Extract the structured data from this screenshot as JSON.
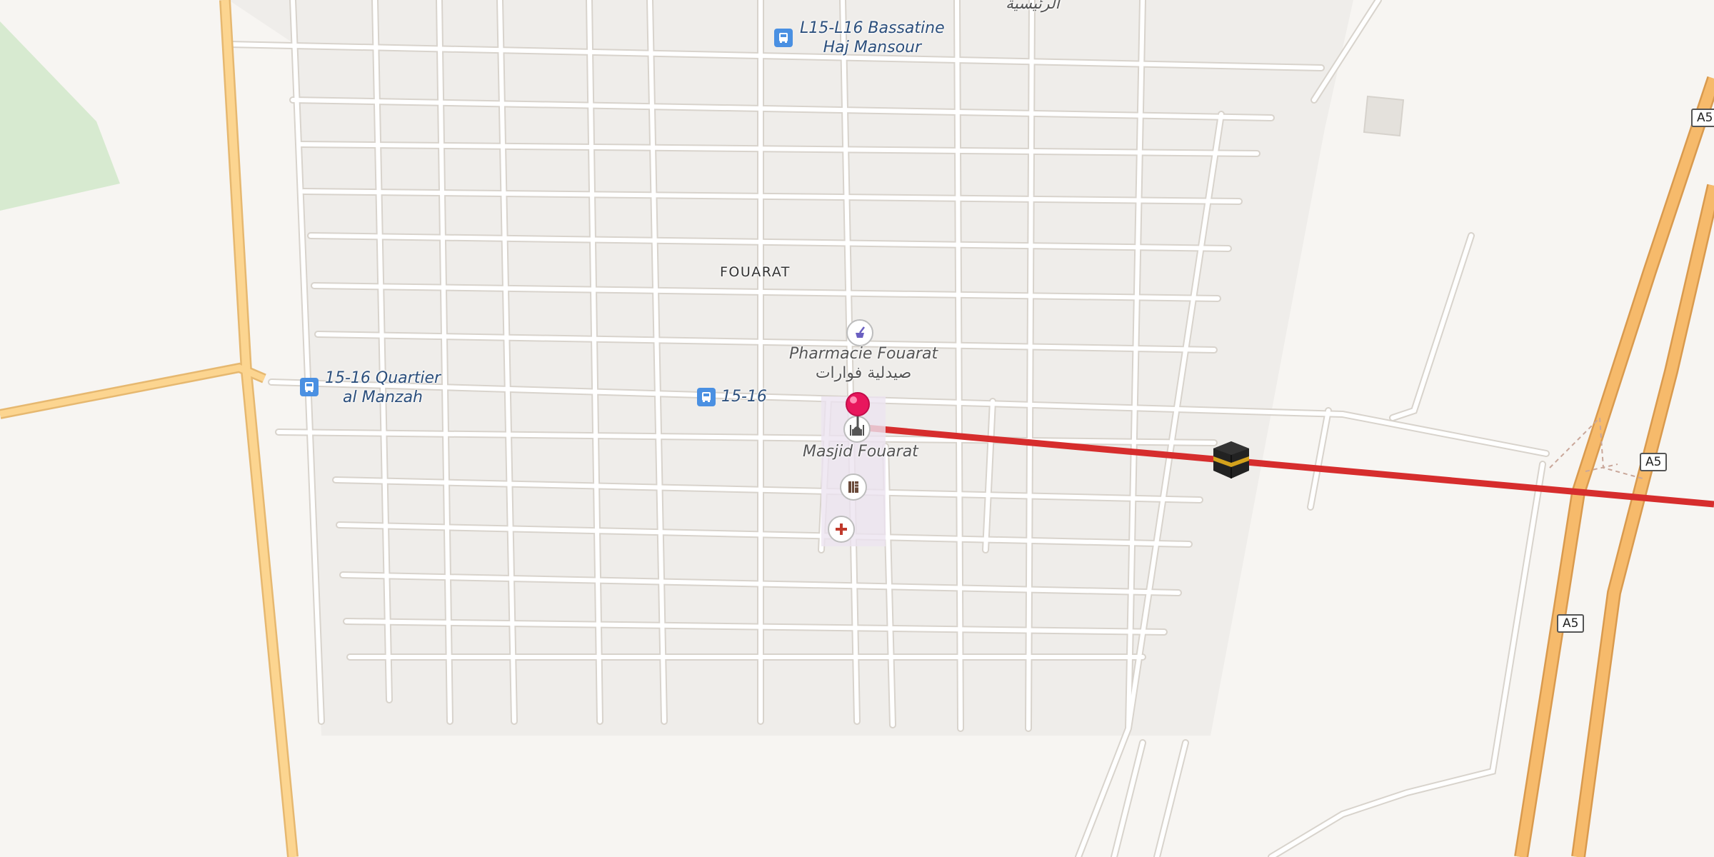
{
  "map": {
    "place_label": "FOUARAT",
    "arabic_top_label": "الرئيسية",
    "bus_stops": [
      {
        "line1": "L15-L16 Bassatine",
        "line2": "Haj Mansour"
      },
      {
        "line1": "15-16 Quartier",
        "line2": "al Manzah"
      },
      {
        "line1": "15-16",
        "line2": ""
      }
    ],
    "pois": {
      "pharmacy": {
        "name": "Pharmacie Fouarat",
        "name_ar": "صيدلية فوارات",
        "icon": "pharmacy-mortar-icon"
      },
      "mosque": {
        "name": "Masjid Fouarat",
        "icon": "mosque-icon"
      },
      "library": {
        "icon": "library-icon"
      },
      "clinic": {
        "icon": "medical-cross-icon"
      }
    },
    "highway_shields": [
      "A5",
      "A5",
      "A5"
    ],
    "marker": {
      "icon": "location-pin-icon",
      "color": "#e8175d"
    },
    "qibla": {
      "icon": "kaaba-icon",
      "line_color": "#d62d2d"
    },
    "colors": {
      "background": "#f7f5f2",
      "residential": "#efedea",
      "road": "#ffffff",
      "road_casing": "#d8d3cc",
      "primary_road": "#fcd590",
      "motorway": "#f6ba6b",
      "park": "#d7ead0",
      "bus_stop": "#4a90e2"
    }
  }
}
